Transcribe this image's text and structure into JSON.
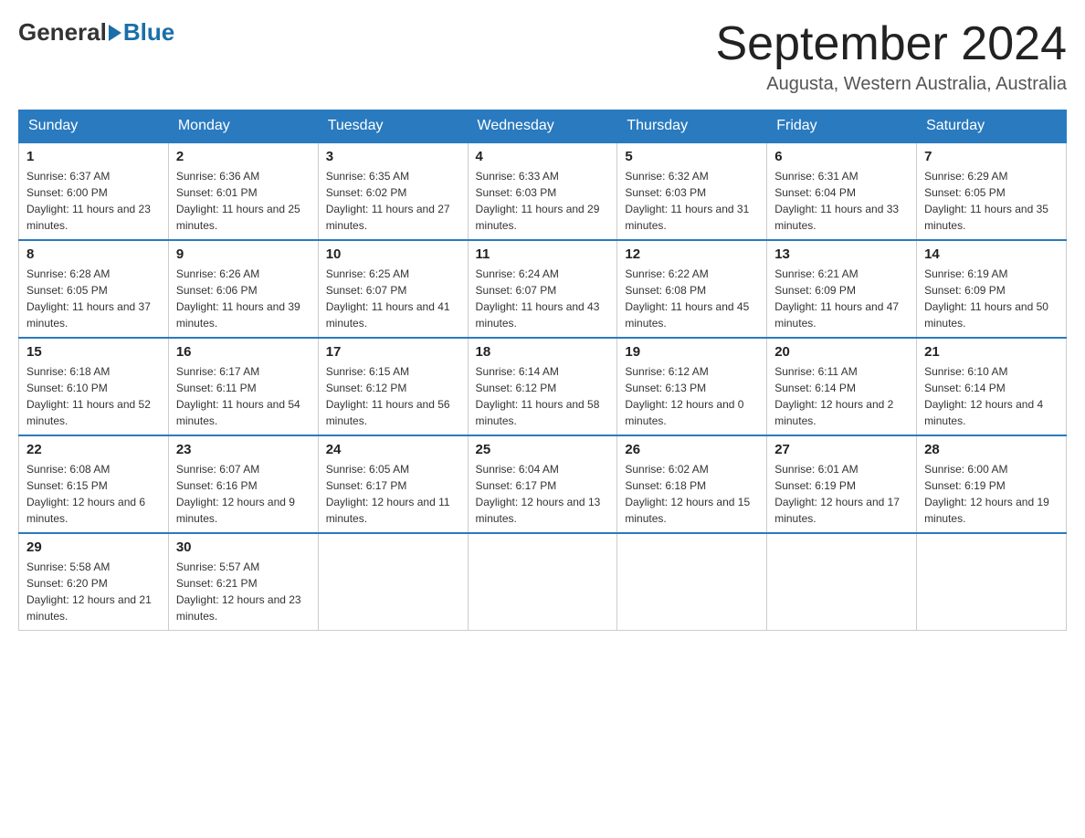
{
  "header": {
    "logo_general": "General",
    "logo_blue": "Blue",
    "month_title": "September 2024",
    "location": "Augusta, Western Australia, Australia"
  },
  "weekdays": [
    "Sunday",
    "Monday",
    "Tuesday",
    "Wednesday",
    "Thursday",
    "Friday",
    "Saturday"
  ],
  "weeks": [
    [
      {
        "day": "1",
        "sunrise": "6:37 AM",
        "sunset": "6:00 PM",
        "daylight": "11 hours and 23 minutes."
      },
      {
        "day": "2",
        "sunrise": "6:36 AM",
        "sunset": "6:01 PM",
        "daylight": "11 hours and 25 minutes."
      },
      {
        "day": "3",
        "sunrise": "6:35 AM",
        "sunset": "6:02 PM",
        "daylight": "11 hours and 27 minutes."
      },
      {
        "day": "4",
        "sunrise": "6:33 AM",
        "sunset": "6:03 PM",
        "daylight": "11 hours and 29 minutes."
      },
      {
        "day": "5",
        "sunrise": "6:32 AM",
        "sunset": "6:03 PM",
        "daylight": "11 hours and 31 minutes."
      },
      {
        "day": "6",
        "sunrise": "6:31 AM",
        "sunset": "6:04 PM",
        "daylight": "11 hours and 33 minutes."
      },
      {
        "day": "7",
        "sunrise": "6:29 AM",
        "sunset": "6:05 PM",
        "daylight": "11 hours and 35 minutes."
      }
    ],
    [
      {
        "day": "8",
        "sunrise": "6:28 AM",
        "sunset": "6:05 PM",
        "daylight": "11 hours and 37 minutes."
      },
      {
        "day": "9",
        "sunrise": "6:26 AM",
        "sunset": "6:06 PM",
        "daylight": "11 hours and 39 minutes."
      },
      {
        "day": "10",
        "sunrise": "6:25 AM",
        "sunset": "6:07 PM",
        "daylight": "11 hours and 41 minutes."
      },
      {
        "day": "11",
        "sunrise": "6:24 AM",
        "sunset": "6:07 PM",
        "daylight": "11 hours and 43 minutes."
      },
      {
        "day": "12",
        "sunrise": "6:22 AM",
        "sunset": "6:08 PM",
        "daylight": "11 hours and 45 minutes."
      },
      {
        "day": "13",
        "sunrise": "6:21 AM",
        "sunset": "6:09 PM",
        "daylight": "11 hours and 47 minutes."
      },
      {
        "day": "14",
        "sunrise": "6:19 AM",
        "sunset": "6:09 PM",
        "daylight": "11 hours and 50 minutes."
      }
    ],
    [
      {
        "day": "15",
        "sunrise": "6:18 AM",
        "sunset": "6:10 PM",
        "daylight": "11 hours and 52 minutes."
      },
      {
        "day": "16",
        "sunrise": "6:17 AM",
        "sunset": "6:11 PM",
        "daylight": "11 hours and 54 minutes."
      },
      {
        "day": "17",
        "sunrise": "6:15 AM",
        "sunset": "6:12 PM",
        "daylight": "11 hours and 56 minutes."
      },
      {
        "day": "18",
        "sunrise": "6:14 AM",
        "sunset": "6:12 PM",
        "daylight": "11 hours and 58 minutes."
      },
      {
        "day": "19",
        "sunrise": "6:12 AM",
        "sunset": "6:13 PM",
        "daylight": "12 hours and 0 minutes."
      },
      {
        "day": "20",
        "sunrise": "6:11 AM",
        "sunset": "6:14 PM",
        "daylight": "12 hours and 2 minutes."
      },
      {
        "day": "21",
        "sunrise": "6:10 AM",
        "sunset": "6:14 PM",
        "daylight": "12 hours and 4 minutes."
      }
    ],
    [
      {
        "day": "22",
        "sunrise": "6:08 AM",
        "sunset": "6:15 PM",
        "daylight": "12 hours and 6 minutes."
      },
      {
        "day": "23",
        "sunrise": "6:07 AM",
        "sunset": "6:16 PM",
        "daylight": "12 hours and 9 minutes."
      },
      {
        "day": "24",
        "sunrise": "6:05 AM",
        "sunset": "6:17 PM",
        "daylight": "12 hours and 11 minutes."
      },
      {
        "day": "25",
        "sunrise": "6:04 AM",
        "sunset": "6:17 PM",
        "daylight": "12 hours and 13 minutes."
      },
      {
        "day": "26",
        "sunrise": "6:02 AM",
        "sunset": "6:18 PM",
        "daylight": "12 hours and 15 minutes."
      },
      {
        "day": "27",
        "sunrise": "6:01 AM",
        "sunset": "6:19 PM",
        "daylight": "12 hours and 17 minutes."
      },
      {
        "day": "28",
        "sunrise": "6:00 AM",
        "sunset": "6:19 PM",
        "daylight": "12 hours and 19 minutes."
      }
    ],
    [
      {
        "day": "29",
        "sunrise": "5:58 AM",
        "sunset": "6:20 PM",
        "daylight": "12 hours and 21 minutes."
      },
      {
        "day": "30",
        "sunrise": "5:57 AM",
        "sunset": "6:21 PM",
        "daylight": "12 hours and 23 minutes."
      },
      null,
      null,
      null,
      null,
      null
    ]
  ]
}
